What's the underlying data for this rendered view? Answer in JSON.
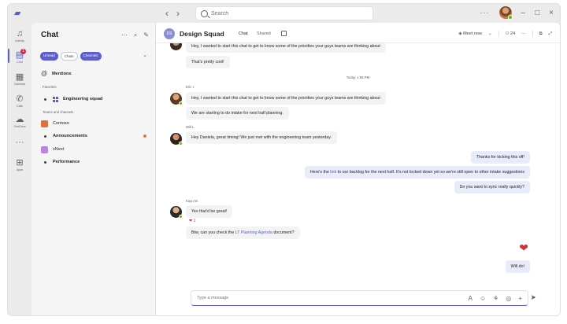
{
  "titlebar": {
    "search_placeholder": "Search",
    "back_glyph": "‹",
    "forward_glyph": "›",
    "more_glyph": "···",
    "minimize_glyph": "–",
    "maximize_glyph": "□",
    "close_glyph": "×"
  },
  "rail": {
    "items": [
      {
        "label": "Activity",
        "icon": "bell-icon"
      },
      {
        "label": "Chat",
        "icon": "chat-icon",
        "badge": "1"
      },
      {
        "label": "Calendar",
        "icon": "calendar-icon"
      },
      {
        "label": "Calls",
        "icon": "phone-icon"
      },
      {
        "label": "OneDrive",
        "icon": "cloud-icon"
      },
      {
        "label": "···",
        "icon": "more-icon"
      },
      {
        "label": "Apps",
        "icon": "apps-icon"
      }
    ]
  },
  "chatlist": {
    "title": "Chat",
    "filters": [
      "Unread",
      "Chats",
      "Channels"
    ],
    "favorites_label": "Favorites",
    "mentions": "Mentions",
    "engineering": "Engineering squad",
    "teams_label": "Teams and channels",
    "contoso": "Contoso",
    "announcements": "Announcements",
    "xnext": "xNext",
    "performance": "Performance"
  },
  "header": {
    "title": "Design Squad",
    "avatar_initials": "DS",
    "tabs": [
      "Chat",
      "Shared"
    ],
    "meet_now": "Meet now",
    "participants": "24"
  },
  "messages": {
    "m1": "Hey, I wanted to start this chat to get to know some of the priorities your guys teams are thinking about",
    "m2": "That's pretty cool!",
    "timestamp": "Today, 1:55 PM",
    "sender_eric": "Eric I.",
    "m3": "Hey, I wanted to start this chat to get to know some of the priorities your guys teams are thinking about",
    "m4": "We are starting to do intake for next half planning.",
    "sender_will": "Will L.",
    "m5": "Hey Daniela, great timing! We just met with the engineering team yesterday.",
    "me1": "Thanks for kicking this off!",
    "me2_pre": "Here's the ",
    "me2_link": "link",
    "me2_post": " to our backlog for the next half. It's not locked down yet so we're still open to other intake suggestions",
    "me3": "Do you want to sync really quickly?",
    "sender_kayo": "Kayo M.",
    "m6": "Yes that'd be great!",
    "reaction": "❤ 1",
    "m7_pre": "Btw, can you check the ",
    "m7_link": "LT Planning Agenda",
    "m7_post": " document?",
    "me4": "Will do!"
  },
  "compose": {
    "placeholder": "Type a message"
  },
  "colors": {
    "brand": "#5b5fc7",
    "my_bubble": "#e8ebfa",
    "their_bubble": "#f3f3f3"
  }
}
